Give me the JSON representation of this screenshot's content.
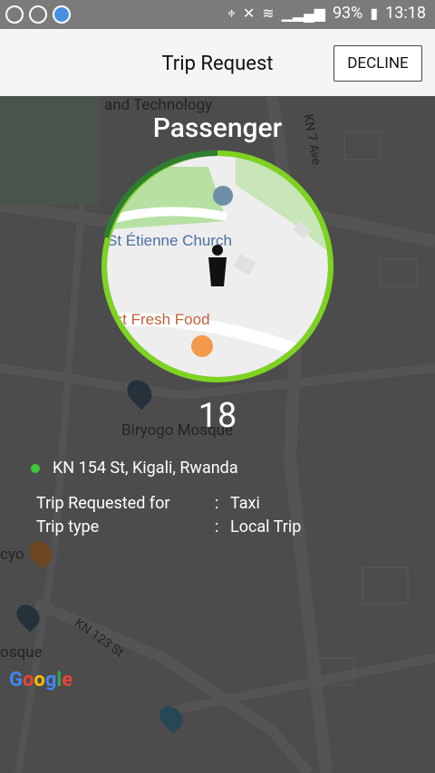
{
  "status": {
    "battery": "93%",
    "time": "13:18",
    "icons": [
      "location-icon",
      "mute-icon",
      "wifi-icon",
      "signal-icon",
      "battery-charging-icon"
    ]
  },
  "header": {
    "title": "Trip Request",
    "decline_label": "DECLINE"
  },
  "map": {
    "labels": {
      "tech": "and Technology",
      "street_kn7": "KN 7 Ave",
      "church": "St Étienne Church",
      "food": "Lius-First Fresh Food",
      "mosque": "Biryogo Mosque",
      "cyo": "cyo",
      "osque": "osque",
      "street_kn123": "KN 123 St"
    },
    "google": [
      "G",
      "o",
      "o",
      "g",
      "l",
      "e"
    ]
  },
  "request": {
    "passenger_label": "Passenger",
    "countdown": "18",
    "countdown_progress": 0.95,
    "address": "KN 154 St, Kigali, Rwanda",
    "details": [
      {
        "label": "Trip Requested for",
        "sep": ":",
        "value": "Taxi"
      },
      {
        "label": "Trip type",
        "sep": ":",
        "value": "Local Trip"
      }
    ]
  },
  "colors": {
    "ring_light": "#7ed321",
    "ring_dark": "#2e7d32",
    "dot": "#3ec63e"
  }
}
